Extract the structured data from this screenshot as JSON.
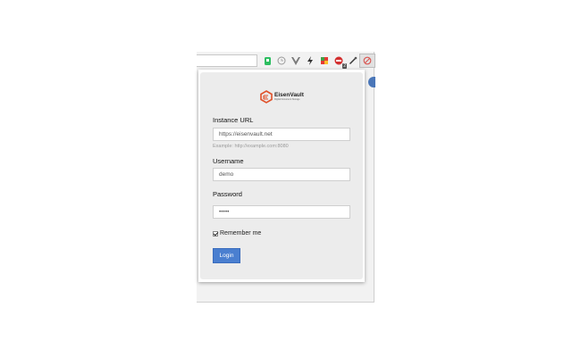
{
  "toolbar": {
    "extensions": [
      {
        "icon": "evernote-icon"
      },
      {
        "icon": "clock-icon"
      },
      {
        "icon": "vue-devtools-icon"
      },
      {
        "icon": "lightning-icon"
      },
      {
        "icon": "puzzle-icon"
      },
      {
        "icon": "adblock-icon",
        "badge": "2"
      },
      {
        "icon": "eyedropper-icon"
      },
      {
        "icon": "eisenvault-icon"
      }
    ]
  },
  "login": {
    "logo_name": "EisenVault",
    "logo_tagline": "Digital Document Storage",
    "instance_label": "Instance URL",
    "instance_value": "https://eisenvault.net",
    "instance_hint": "Example: http://example.com:8080",
    "username_label": "Username",
    "username_value": "demo",
    "password_label": "Password",
    "password_value": "•••••",
    "remember_label": "Remember me",
    "remember_checked": true,
    "login_button": "Login"
  },
  "colors": {
    "accent": "#4a7fd0",
    "logo_orange": "#e0512a",
    "panel_bg": "#ececec"
  }
}
